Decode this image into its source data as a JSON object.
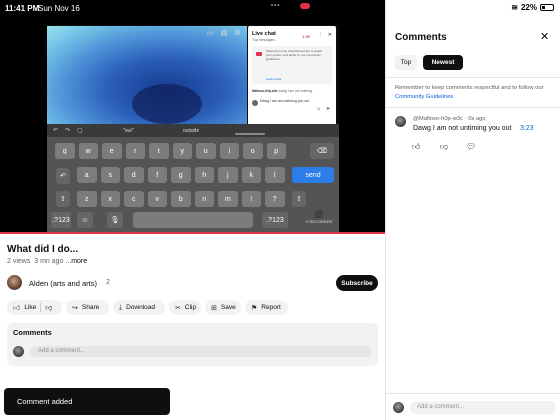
{
  "status_bar": {
    "time": "11:41 PM",
    "date": "Sun Nov 16",
    "battery": "22%"
  },
  "live_chat": {
    "title": "Live chat",
    "subtitle": "Top messages",
    "badge": "1.3K",
    "welcome_text": "Welcome to live chat! Remember to guard your privacy and abide by our community guidelines.",
    "learn_more": "Learn more",
    "message_author": "Mafioso-h0p-w3c",
    "message_text": "Dawg I am not untiming",
    "input_text": "Dawg I am not untiming you out"
  },
  "keyboard": {
    "suggestions": [
      "\"out\"",
      "outside"
    ],
    "row1": [
      "q",
      "w",
      "e",
      "r",
      "t",
      "y",
      "u",
      "i",
      "o",
      "p"
    ],
    "row2": [
      "a",
      "s",
      "d",
      "f",
      "g",
      "h",
      "j",
      "k",
      "l"
    ],
    "row3": [
      "z",
      "x",
      "c",
      "v",
      "b",
      "n",
      "m",
      "!",
      "?"
    ],
    "send": "send",
    "numbers": ".?123",
    "record_label": "REC",
    "recorder_label": "V RECORDER"
  },
  "video": {
    "title": "What did I do...",
    "views": "2 views",
    "age": "3 mn ago",
    "more": "...more",
    "channel_name": "Alden (arts and arts)",
    "subscribers": "2",
    "subscribe_label": "Subscribe",
    "progress_fraction": 1.0
  },
  "actions": {
    "like": "Like",
    "share": "Share",
    "download": "Download",
    "clip": "Clip",
    "save": "Save",
    "report": "Report"
  },
  "comments_box": {
    "title": "Comments",
    "placeholder": "Add a comment..."
  },
  "toast": {
    "text": "Comment added"
  },
  "panel": {
    "title": "Comments",
    "tab_top": "Top",
    "tab_newest": "Newest",
    "guidelines_text": "Remember to keep comments respectful and to follow our",
    "guidelines_link": "Community Guidelines",
    "comment": {
      "author": "@Mafioso-h0p-w3c",
      "age": "0s ago",
      "text": "Dawg I am not untiming you out",
      "timestamp": "3:23"
    },
    "input_placeholder": "Add a comment..."
  },
  "colors": {
    "accent_red": "#e0314b",
    "link_blue": "#065fd4",
    "send_blue": "#2b7de9"
  }
}
